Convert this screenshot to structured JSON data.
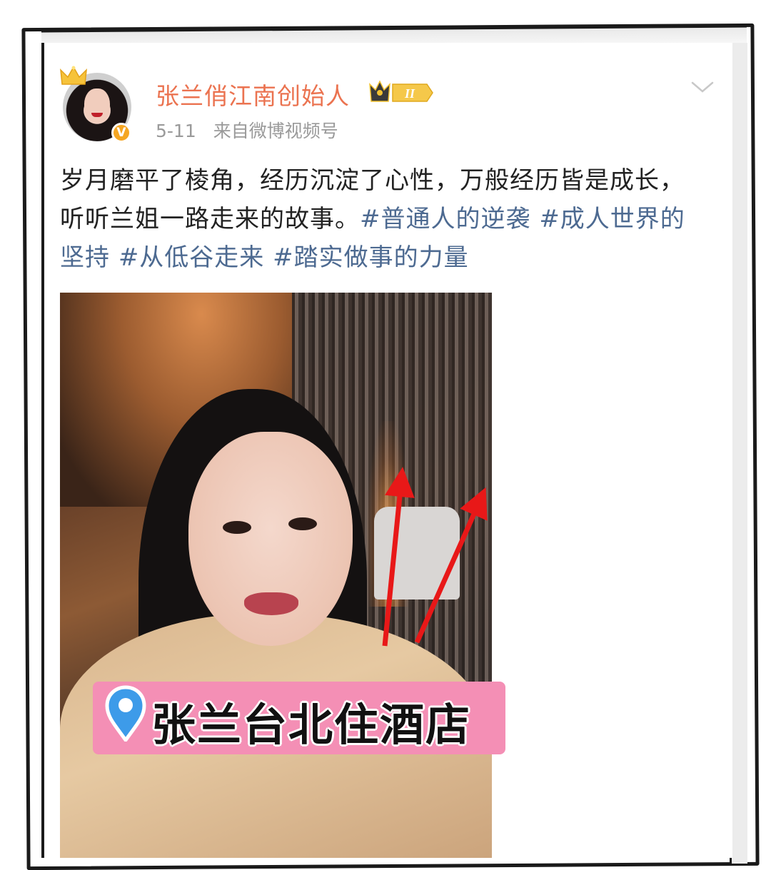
{
  "post": {
    "username": "张兰俏江南创始人",
    "level_badge": "II",
    "date": "5-11",
    "source": "来自微博视频号",
    "verified_mark": "V",
    "text_plain_1": "岁月磨平了棱角，经历沉淀了心性，万般经历皆是成长，听听兰姐一路走来的故事。",
    "hashtag_1": "#普通人的逆袭",
    "hashtag_2": "#成人世界的坚持",
    "hashtag_3": "#从低谷走来",
    "hashtag_4": "#踏实做事的力量"
  },
  "video": {
    "location_label": "张兰台北住酒店"
  },
  "icons": {
    "crown": "crown-icon",
    "verified": "verified-badge-icon",
    "level": "level-badge-icon",
    "more": "chevron-down-icon",
    "pin": "location-pin-icon"
  },
  "colors": {
    "username": "#eb7350",
    "hashtag": "#4d6a91",
    "meta": "#9a9a9a",
    "tag_bg": "#f48fb5",
    "arrow": "#e81818",
    "pin": "#3d9be9"
  }
}
